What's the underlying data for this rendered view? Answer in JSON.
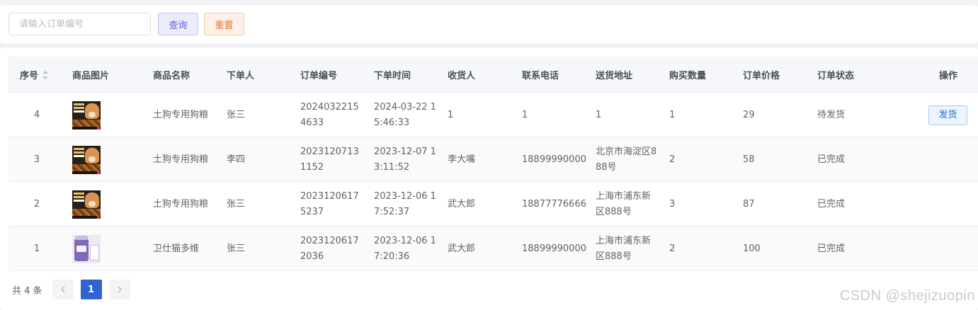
{
  "search": {
    "placeholder": "请输入订单编号",
    "value": "",
    "query_label": "查询",
    "reset_label": "重置"
  },
  "table": {
    "columns": [
      "序号",
      "商品图片",
      "商品名称",
      "下单人",
      "订单编号",
      "下单时间",
      "收货人",
      "联系电话",
      "送货地址",
      "购买数量",
      "订单价格",
      "订单状态",
      "操作"
    ],
    "rows": [
      {
        "index": "4",
        "image": "dog-food-image",
        "product": "土狗专用狗粮",
        "buyer": "张三",
        "order_no": "20240322154633",
        "time": "2024-03-22 15:46:33",
        "receiver": "1",
        "phone": "1",
        "address": "1",
        "qty": "1",
        "price": "29",
        "status": "待发货",
        "action": "发货"
      },
      {
        "index": "3",
        "image": "dog-food-image",
        "product": "土狗专用狗粮",
        "buyer": "李四",
        "order_no": "20231207131152",
        "time": "2023-12-07 13:11:52",
        "receiver": "李大嘴",
        "phone": "18899990000",
        "address": "北京市海淀区888号",
        "qty": "2",
        "price": "58",
        "status": "已完成",
        "action": ""
      },
      {
        "index": "2",
        "image": "dog-food-image",
        "product": "土狗专用狗粮",
        "buyer": "张三",
        "order_no": "20231206175237",
        "time": "2023-12-06 17:52:37",
        "receiver": "武大郎",
        "phone": "18877776666",
        "address": "上海市浦东新区888号",
        "qty": "3",
        "price": "87",
        "status": "已完成",
        "action": ""
      },
      {
        "index": "1",
        "image": "cat-vitamin-image",
        "product": "卫仕猫多维",
        "buyer": "张三",
        "order_no": "20231206172036",
        "time": "2023-12-06 17:20:36",
        "receiver": "武大郎",
        "phone": "18899990000",
        "address": "上海市浦东新区888号",
        "qty": "2",
        "price": "100",
        "status": "已完成",
        "action": ""
      }
    ]
  },
  "pagination": {
    "total_label": "共 4 条",
    "current_page": "1",
    "prev_icon": "chevron-left-icon",
    "next_icon": "chevron-right-icon"
  },
  "watermark": "CSDN @shejizuopin",
  "colors": {
    "accent": "#2f64d1",
    "query_button": "#6760d8",
    "reset_button": "#e8783e"
  }
}
